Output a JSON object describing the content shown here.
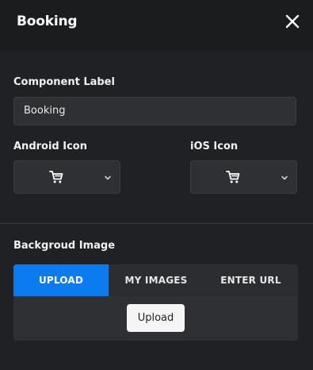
{
  "header": {
    "title": "Booking",
    "close_icon": "close-icon"
  },
  "fields": {
    "component_label": {
      "label": "Component Label",
      "value": "Booking"
    },
    "android_icon": {
      "label": "Android Icon",
      "icon": "shopping-cart-icon"
    },
    "ios_icon": {
      "label": "iOS Icon",
      "icon": "shopping-cart-icon"
    }
  },
  "background_image": {
    "label": "Backgroud Image",
    "tabs": [
      {
        "label": "UPLOAD",
        "active": true
      },
      {
        "label": "MY IMAGES",
        "active": false
      },
      {
        "label": "ENTER URL",
        "active": false
      }
    ],
    "upload_button": "Upload"
  },
  "colors": {
    "accent": "#0a7cf0",
    "background": "#202124",
    "header": "#1b1c1e",
    "field": "#2e3034"
  }
}
